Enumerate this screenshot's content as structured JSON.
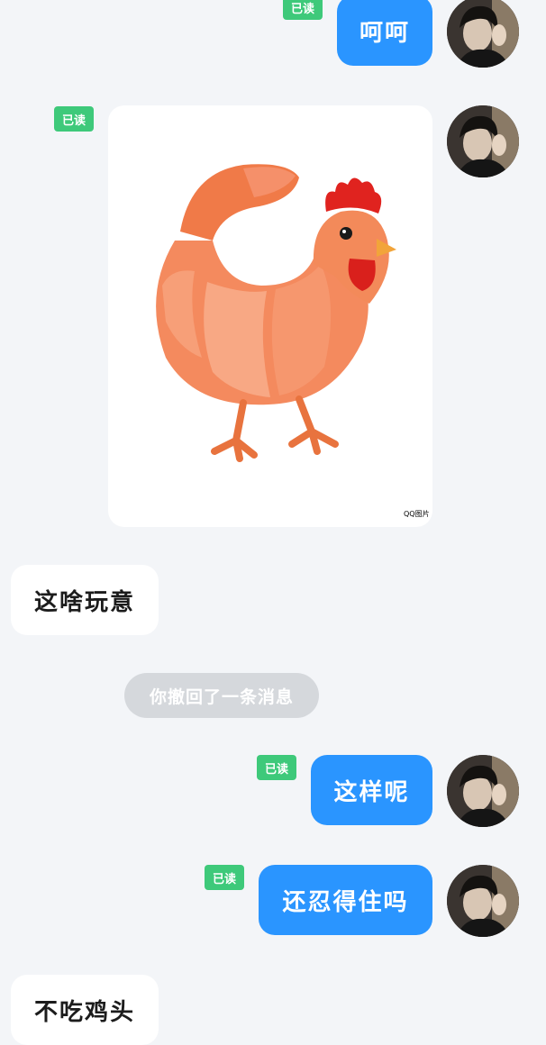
{
  "messages": {
    "m1": {
      "text": "呵呵",
      "read": "已读"
    },
    "m2": {
      "read": "已读",
      "watermark": "QQ图片"
    },
    "m3": {
      "text": "这啥玩意"
    },
    "recall": {
      "text": "你撤回了一条消息"
    },
    "m4": {
      "text": "这样呢",
      "read": "已读"
    },
    "m5": {
      "text": "还忍得住吗",
      "read": "已读"
    },
    "m6": {
      "text": "不吃鸡头"
    }
  },
  "colors": {
    "background": "#f3f5f8",
    "outgoing_bubble": "#2a95ff",
    "incoming_bubble": "#ffffff",
    "read_badge": "#3ec97a",
    "recall_pill": "#d5d8dc"
  },
  "icons": {
    "avatar": "user-avatar-photo",
    "sticker": "shrimp-chicken-sticker"
  }
}
